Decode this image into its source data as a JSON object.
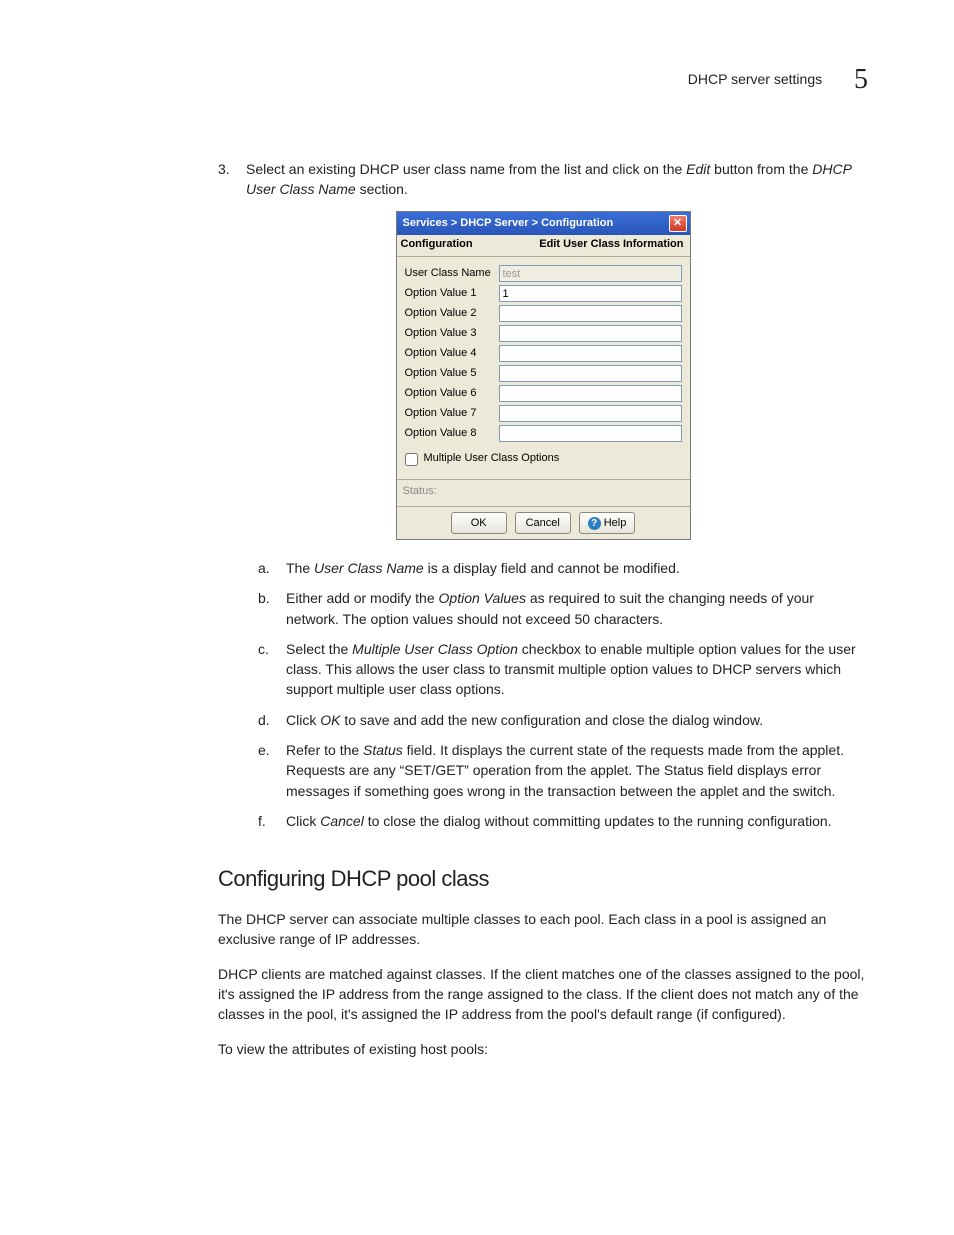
{
  "header": {
    "title": "DHCP server settings",
    "chapter_number": "5"
  },
  "step3": {
    "marker": "3.",
    "pre": "Select an existing DHCP user class name from the list and click on the ",
    "edit_i": "Edit",
    "mid": " button from the ",
    "section_i": "DHCP User Class Name",
    "post": " section."
  },
  "dialog": {
    "breadcrumb": "Services > DHCP Server > Configuration",
    "close_glyph": "✕",
    "sub_left": "Configuration",
    "sub_right": "Edit User Class Information",
    "rows": {
      "user_class_label": "User Class Name",
      "user_class_value": "test",
      "opt1_label": "Option Value 1",
      "opt1_value": "1",
      "opt2_label": "Option Value 2",
      "opt3_label": "Option Value 3",
      "opt4_label": "Option Value 4",
      "opt5_label": "Option Value 5",
      "opt6_label": "Option Value 6",
      "opt7_label": "Option Value 7",
      "opt8_label": "Option Value 8"
    },
    "checkbox_label": "Multiple User Class Options",
    "status_label": "Status:",
    "buttons": {
      "ok": "OK",
      "cancel": "Cancel",
      "help": "Help",
      "help_glyph": "?"
    }
  },
  "substeps": {
    "a": {
      "marker": "a.",
      "pre": "The ",
      "i1": "User Class Name",
      "post": " is a display field and cannot be modified."
    },
    "b": {
      "marker": "b.",
      "pre": "Either add or modify the ",
      "i1": "Option Values",
      "post": " as required to suit the changing needs of your network. The option values should not exceed 50 characters."
    },
    "c": {
      "marker": "c.",
      "pre": "Select the ",
      "i1": "Multiple User Class Option",
      "post": " checkbox to enable multiple option values for the user class. This allows the user class to transmit multiple option values to DHCP servers which support multiple user class options."
    },
    "d": {
      "marker": "d.",
      "pre": "Click ",
      "i1": "OK",
      "post": " to save and add the new configuration and close the dialog window."
    },
    "e": {
      "marker": "e.",
      "pre": "Refer to the ",
      "i1": "Status",
      "post": " field. It displays the current state of the requests made from the applet. Requests are any “SET/GET” operation from the applet. The Status field displays error messages if something goes wrong in the transaction between the applet and the switch."
    },
    "f": {
      "marker": "f.",
      "pre": "Click ",
      "i1": "Cancel",
      "post": " to close the dialog without committing updates to the running configuration."
    }
  },
  "section2": {
    "heading": "Configuring DHCP pool class",
    "p1": "The DHCP server can associate multiple classes to each pool. Each class in a pool is assigned an exclusive range of IP addresses.",
    "p2": "DHCP clients are matched against classes. If the client matches one of the classes assigned to the pool, it's assigned the IP address from the range assigned to the class. If the client does not match any of the classes in the pool, it's assigned the IP address from the pool's default range (if configured).",
    "p3": "To view the attributes of existing host pools:"
  }
}
